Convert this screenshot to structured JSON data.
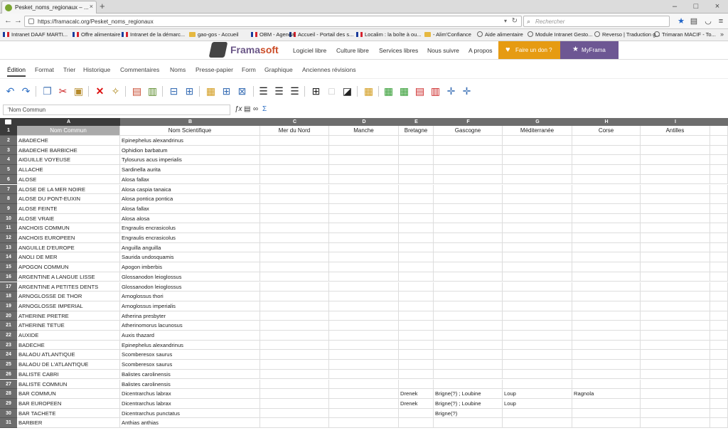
{
  "browser": {
    "tab_title": "Pesket_noms_regionaux – ...",
    "url": "https://framacalc.org/Pesket_noms_regionaux",
    "search_placeholder": "Rechercher",
    "bookmarks": [
      {
        "label": "Intranet DAAF MARTI...",
        "icon": "flag"
      },
      {
        "label": "Offre alimentaire",
        "icon": "flag"
      },
      {
        "label": "Intranet de la démarc...",
        "icon": "flag"
      },
      {
        "label": "gao-gos - Accueil",
        "icon": "folder"
      },
      {
        "label": "OBM - Agenda",
        "icon": "flag"
      },
      {
        "label": "Accueil - Portail des s...",
        "icon": "flag"
      },
      {
        "label": "Localim : la boîte à ou...",
        "icon": "flag"
      },
      {
        "label": "- Alim'Confiance",
        "icon": "folder"
      },
      {
        "label": "Aide alimentaire",
        "icon": "globe"
      },
      {
        "label": "Module Intranet Gesto...",
        "icon": "globe"
      },
      {
        "label": "Reverso | Traduction g...",
        "icon": "globe"
      },
      {
        "label": "Trimaran MACIF - To...",
        "icon": "globe"
      }
    ],
    "bookmarks_more": "»"
  },
  "framasoft": {
    "logo_prefix": "Frama",
    "logo_suffix": "soft",
    "nav": [
      "Logiciel libre",
      "Culture libre",
      "Services libres",
      "Nous suivre",
      "A propos"
    ],
    "donate_label": "Faire un don ?",
    "myframa_label": "MyFrama"
  },
  "menu": [
    "Édition",
    "Format",
    "Trier",
    "Historique",
    "Commentaires",
    "Noms",
    "Presse-papier",
    "Form",
    "Graphique",
    "Anciennes révisions"
  ],
  "formula_bar": {
    "cell_value": "'Nom Commun"
  },
  "sheet": {
    "columns": [
      {
        "letter": "A",
        "header": "Nom Commun"
      },
      {
        "letter": "B",
        "header": "Nom Scientifique"
      },
      {
        "letter": "C",
        "header": "Mer du Nord"
      },
      {
        "letter": "D",
        "header": "Manche"
      },
      {
        "letter": "E",
        "header": "Bretagne"
      },
      {
        "letter": "F",
        "header": "Gascogne"
      },
      {
        "letter": "G",
        "header": "Méditerranée"
      },
      {
        "letter": "H",
        "header": "Corse"
      },
      {
        "letter": "I",
        "header": "Antilles"
      }
    ],
    "rows": [
      {
        "n": "2",
        "cells": [
          "ABADECHE",
          "Epinephelus alexandrinus",
          "",
          "",
          "",
          "",
          "",
          "",
          ""
        ]
      },
      {
        "n": "3",
        "cells": [
          "ABADECHE BARBICHE",
          "Ophidion barbatum",
          "",
          "",
          "",
          "",
          "",
          "",
          ""
        ]
      },
      {
        "n": "4",
        "cells": [
          "AIGUILLE VOYEUSE",
          "Tylosurus acus imperialis",
          "",
          "",
          "",
          "",
          "",
          "",
          ""
        ]
      },
      {
        "n": "5",
        "cells": [
          "ALLACHE",
          "Sardinella aurita",
          "",
          "",
          "",
          "",
          "",
          "",
          ""
        ]
      },
      {
        "n": "6",
        "cells": [
          "ALOSE",
          "Alosa fallax",
          "",
          "",
          "",
          "",
          "",
          "",
          ""
        ]
      },
      {
        "n": "7",
        "cells": [
          "ALOSE DE LA MER NOIRE",
          "Alosa caspia tanaica",
          "",
          "",
          "",
          "",
          "",
          "",
          ""
        ]
      },
      {
        "n": "8",
        "cells": [
          "ALOSE DU PONT-EUXIN",
          "Alosa pontica pontica",
          "",
          "",
          "",
          "",
          "",
          "",
          ""
        ]
      },
      {
        "n": "9",
        "cells": [
          "ALOSE FEINTE",
          "Alosa fallax",
          "",
          "",
          "",
          "",
          "",
          "",
          ""
        ]
      },
      {
        "n": "10",
        "cells": [
          "ALOSE VRAIE",
          "Alosa alosa",
          "",
          "",
          "",
          "",
          "",
          "",
          ""
        ]
      },
      {
        "n": "11",
        "cells": [
          "ANCHOIS COMMUN",
          "Engraulis encrasicolus",
          "",
          "",
          "",
          "",
          "",
          "",
          ""
        ]
      },
      {
        "n": "12",
        "cells": [
          "ANCHOIS EUROPEEN",
          "Engraulis encrasicolus",
          "",
          "",
          "",
          "",
          "",
          "",
          ""
        ]
      },
      {
        "n": "13",
        "cells": [
          "ANGUILLE D'EUROPE",
          "Anguilla anguilla",
          "",
          "",
          "",
          "",
          "",
          "",
          ""
        ]
      },
      {
        "n": "14",
        "cells": [
          "ANOLI DE MER",
          "Saurida undosquamis",
          "",
          "",
          "",
          "",
          "",
          "",
          ""
        ]
      },
      {
        "n": "15",
        "cells": [
          "APOGON COMMUN",
          "Apogon imberbis",
          "",
          "",
          "",
          "",
          "",
          "",
          ""
        ]
      },
      {
        "n": "16",
        "cells": [
          "ARGENTINE A LANGUE LISSE",
          "Glossanodon leioglossus",
          "",
          "",
          "",
          "",
          "",
          "",
          ""
        ]
      },
      {
        "n": "17",
        "cells": [
          "ARGENTINE A PETITES DENTS",
          "Glossanodon leioglossus",
          "",
          "",
          "",
          "",
          "",
          "",
          ""
        ]
      },
      {
        "n": "18",
        "cells": [
          "ARNOGLOSSE DE THOR",
          "Arnoglossus thori",
          "",
          "",
          "",
          "",
          "",
          "",
          ""
        ]
      },
      {
        "n": "19",
        "cells": [
          "ARNOGLOSSE IMPERIAL",
          "Arnoglossus imperialis",
          "",
          "",
          "",
          "",
          "",
          "",
          ""
        ]
      },
      {
        "n": "20",
        "cells": [
          "ATHERINE PRETRE",
          "Atherina presbyter",
          "",
          "",
          "",
          "",
          "",
          "",
          ""
        ]
      },
      {
        "n": "21",
        "cells": [
          "ATHERINE TETUE",
          "Atherinomorus lacunosus",
          "",
          "",
          "",
          "",
          "",
          "",
          ""
        ]
      },
      {
        "n": "22",
        "cells": [
          "AUXIDE",
          "Auxis thazard",
          "",
          "",
          "",
          "",
          "",
          "",
          ""
        ]
      },
      {
        "n": "23",
        "cells": [
          "BADECHE",
          "Epinephelus alexandrinus",
          "",
          "",
          "",
          "",
          "",
          "",
          ""
        ]
      },
      {
        "n": "24",
        "cells": [
          "BALAOU ATLANTIQUE",
          "Scomberesox saurus",
          "",
          "",
          "",
          "",
          "",
          "",
          ""
        ]
      },
      {
        "n": "25",
        "cells": [
          "BALAOU DE L'ATLANTIQUE",
          "Scomberesox saurus",
          "",
          "",
          "",
          "",
          "",
          "",
          ""
        ]
      },
      {
        "n": "26",
        "cells": [
          "BALISTE CABRI",
          "Balistes carolinensis",
          "",
          "",
          "",
          "",
          "",
          "",
          ""
        ]
      },
      {
        "n": "27",
        "cells": [
          "BALISTE COMMUN",
          "Balistes carolinensis",
          "",
          "",
          "",
          "",
          "",
          "",
          ""
        ]
      },
      {
        "n": "28",
        "cells": [
          "BAR COMMUN",
          "Dicentrarchus labrax",
          "",
          "",
          "Drenek",
          "Brigne(?) ; Loubine",
          "Loup",
          "Ragnola",
          ""
        ]
      },
      {
        "n": "29",
        "cells": [
          "BAR EUROPEEN",
          "Dicentrarchus labrax",
          "",
          "",
          "Drenek",
          "Brigne(?) ; Loubine",
          "Loup",
          "",
          ""
        ]
      },
      {
        "n": "30",
        "cells": [
          "BAR TACHETE",
          "Dicentrarchus punctatus",
          "",
          "",
          "",
          "Brigne(?)",
          "",
          "",
          ""
        ]
      },
      {
        "n": "31",
        "cells": [
          "BARBIER",
          "Anthias anthias",
          "",
          "",
          "",
          "",
          "",
          "",
          ""
        ]
      }
    ]
  }
}
